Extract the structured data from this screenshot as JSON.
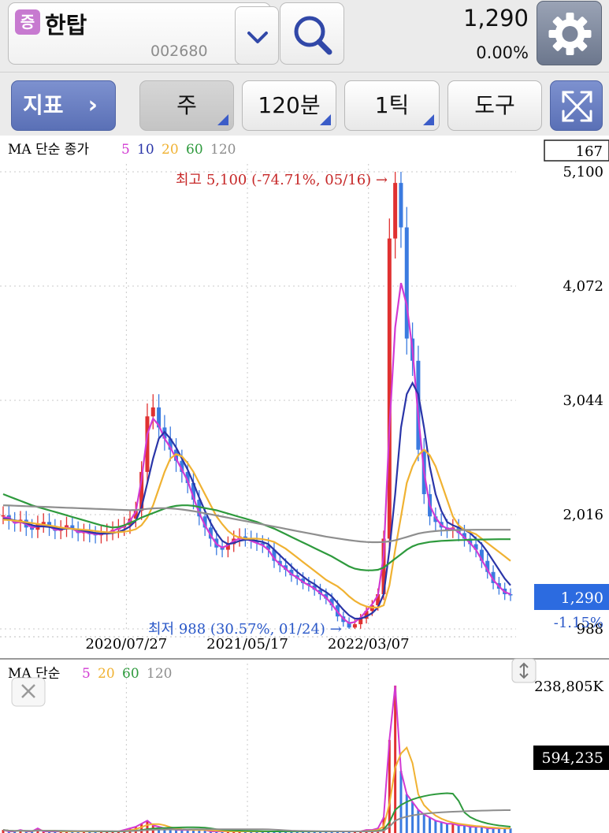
{
  "header": {
    "badge": "증",
    "stock_name": "한탑",
    "stock_code": "002680",
    "price": "1,290",
    "change_pct": "0.00%",
    "icons": [
      "chevron-down-icon",
      "search-icon",
      "gear-icon"
    ]
  },
  "toolbar": {
    "indicator_label": "지표",
    "week_label": "주",
    "minute_label": "120분",
    "tick_label": "1틱",
    "tool_label": "도구",
    "expand_icon": "expand-icon"
  },
  "legend_main": {
    "prefix": "MA 단순 종가",
    "periods": [
      {
        "label": "5",
        "color": "#d23ad3"
      },
      {
        "label": "10",
        "color": "#2a35a8"
      },
      {
        "label": "20",
        "color": "#f0b232"
      },
      {
        "label": "60",
        "color": "#2e9a3d"
      },
      {
        "label": "120",
        "color": "#8e8e8e"
      }
    ]
  },
  "legend_volume": {
    "prefix": "MA 단순",
    "periods": [
      {
        "label": "5",
        "color": "#d23ad3"
      },
      {
        "label": "20",
        "color": "#f0b232"
      },
      {
        "label": "60",
        "color": "#2e9a3d"
      },
      {
        "label": "120",
        "color": "#8e8e8e"
      }
    ]
  },
  "chart_data": {
    "type": "line",
    "title": "",
    "y_ticks": [
      "5,100",
      "4,072",
      "3,044",
      "2,016",
      "988"
    ],
    "y_range": [
      988,
      5100
    ],
    "x_ticks": [
      "2020/07/27",
      "2021/05/17",
      "2022/03/07"
    ],
    "top_box_value": "167",
    "current_price_label": "1,290",
    "current_change_label": "-1.15%",
    "high_annotation": "최고 5,100 (-74.71%, 05/16) →",
    "low_annotation": "최저 988 (30.57%, 01/24) →",
    "grid": true,
    "price_series": [
      2010,
      1960,
      1940,
      1970,
      1900,
      1880,
      1930,
      1950,
      1900,
      1870,
      1890,
      1920,
      1880,
      1850,
      1860,
      1840,
      1830,
      1850,
      1860,
      1880,
      1900,
      1920,
      1980,
      2050,
      2400,
      2900,
      2980,
      2800,
      2700,
      2600,
      2500,
      2400,
      2300,
      2150,
      2000,
      1900,
      1800,
      1720,
      1700,
      1750,
      1800,
      1820,
      1800,
      1780,
      1760,
      1740,
      1700,
      1600,
      1560,
      1520,
      1470,
      1440,
      1400,
      1380,
      1340,
      1300,
      1260,
      1200,
      1100,
      1050,
      1000,
      1030,
      1080,
      1150,
      1200,
      1300,
      1800,
      4500,
      5000,
      4600,
      3600,
      3400,
      2600,
      2200,
      2000,
      1950,
      1900,
      1880,
      1900,
      1850,
      1800,
      1750,
      1700,
      1600,
      1500,
      1400,
      1350,
      1300,
      1290
    ],
    "ma_series": [
      {
        "name": "5",
        "values": [
          1990,
          1990,
          1940,
          1950,
          1930,
          1900,
          1910,
          1920,
          1910,
          1880,
          1880,
          1900,
          1890,
          1860,
          1860,
          1850,
          1840,
          1840,
          1850,
          1870,
          1890,
          1910,
          1960,
          2040,
          2330,
          2740,
          2880,
          2820,
          2700,
          2620,
          2520,
          2420,
          2320,
          2170,
          2030,
          1920,
          1830,
          1750,
          1720,
          1740,
          1780,
          1800,
          1800,
          1780,
          1760,
          1740,
          1700,
          1620,
          1570,
          1530,
          1480,
          1450,
          1410,
          1380,
          1350,
          1310,
          1270,
          1210,
          1140,
          1080,
          1040,
          1050,
          1090,
          1150,
          1210,
          1290,
          1650,
          2800,
          3700,
          4100,
          3900,
          3500,
          2900,
          2400,
          2100,
          1990,
          1920,
          1890,
          1890,
          1860,
          1810,
          1760,
          1700,
          1610,
          1520,
          1430,
          1370,
          1320,
          1300
        ]
      },
      {
        "name": "10",
        "values": [
          1980,
          1975,
          1965,
          1955,
          1940,
          1920,
          1910,
          1910,
          1905,
          1895,
          1885,
          1890,
          1890,
          1880,
          1870,
          1860,
          1850,
          1845,
          1845,
          1850,
          1860,
          1880,
          1910,
          1960,
          2080,
          2300,
          2520,
          2700,
          2760,
          2700,
          2620,
          2520,
          2420,
          2300,
          2170,
          2050,
          1940,
          1850,
          1780,
          1750,
          1760,
          1780,
          1790,
          1790,
          1780,
          1770,
          1750,
          1700,
          1650,
          1600,
          1550,
          1500,
          1460,
          1420,
          1390,
          1350,
          1320,
          1280,
          1220,
          1160,
          1110,
          1080,
          1080,
          1100,
          1130,
          1180,
          1300,
          1700,
          2200,
          2800,
          3100,
          3200,
          3100,
          2800,
          2450,
          2200,
          2050,
          1950,
          1920,
          1900,
          1880,
          1850,
          1800,
          1750,
          1680,
          1600,
          1520,
          1440,
          1380
        ]
      },
      {
        "name": "20",
        "values": [
          1970,
          1968,
          1962,
          1955,
          1948,
          1940,
          1932,
          1925,
          1918,
          1910,
          1900,
          1893,
          1888,
          1884,
          1880,
          1875,
          1868,
          1862,
          1858,
          1856,
          1858,
          1862,
          1870,
          1885,
          1920,
          1990,
          2100,
          2250,
          2400,
          2520,
          2560,
          2540,
          2480,
          2400,
          2300,
          2200,
          2100,
          2000,
          1930,
          1870,
          1830,
          1810,
          1800,
          1800,
          1800,
          1795,
          1785,
          1770,
          1740,
          1710,
          1670,
          1630,
          1590,
          1550,
          1510,
          1470,
          1430,
          1400,
          1370,
          1330,
          1280,
          1240,
          1210,
          1190,
          1180,
          1180,
          1200,
          1380,
          1700,
          2000,
          2300,
          2450,
          2550,
          2600,
          2550,
          2450,
          2300,
          2150,
          2000,
          1920,
          1880,
          1860,
          1840,
          1800,
          1760,
          1720,
          1680,
          1640,
          1600
        ]
      },
      {
        "name": "60",
        "values": [
          2200,
          2180,
          2160,
          2140,
          2120,
          2100,
          2085,
          2070,
          2055,
          2040,
          2025,
          2010,
          1995,
          1980,
          1965,
          1950,
          1935,
          1920,
          1910,
          1900,
          1905,
          1920,
          1940,
          1965,
          1990,
          2010,
          2030,
          2050,
          2070,
          2085,
          2095,
          2100,
          2100,
          2095,
          2085,
          2075,
          2065,
          2055,
          2040,
          2025,
          2010,
          1995,
          1980,
          1965,
          1950,
          1930,
          1910,
          1890,
          1865,
          1840,
          1815,
          1790,
          1765,
          1740,
          1715,
          1690,
          1665,
          1640,
          1610,
          1580,
          1550,
          1530,
          1520,
          1515,
          1515,
          1520,
          1540,
          1580,
          1620,
          1660,
          1700,
          1730,
          1750,
          1760,
          1770,
          1775,
          1780,
          1782,
          1785,
          1787,
          1788,
          1790,
          1791,
          1792,
          1793,
          1794,
          1795,
          1795,
          1795
        ]
      },
      {
        "name": "120",
        "values": [
          2100,
          2098,
          2096,
          2094,
          2092,
          2090,
          2088,
          2086,
          2084,
          2082,
          2080,
          2078,
          2076,
          2074,
          2072,
          2070,
          2068,
          2066,
          2064,
          2062,
          2060,
          2058,
          2056,
          2058,
          2062,
          2068,
          2072,
          2074,
          2074,
          2072,
          2068,
          2062,
          2055,
          2047,
          2038,
          2028,
          2018,
          2008,
          1998,
          1988,
          1978,
          1968,
          1958,
          1948,
          1938,
          1928,
          1918,
          1908,
          1898,
          1888,
          1878,
          1868,
          1858,
          1848,
          1838,
          1828,
          1818,
          1810,
          1802,
          1794,
          1786,
          1780,
          1774,
          1770,
          1768,
          1768,
          1770,
          1775,
          1785,
          1800,
          1815,
          1830,
          1845,
          1855,
          1862,
          1868,
          1872,
          1874,
          1876,
          1877,
          1878,
          1879,
          1880,
          1880,
          1880,
          1880,
          1880,
          1880,
          1880
        ]
      }
    ],
    "volume_ticks": [
      "238,805K"
    ],
    "volume_box_value": "594,235",
    "volume_series": [
      2,
      1,
      1,
      2,
      1,
      1,
      3,
      1,
      1,
      1,
      1,
      1,
      1,
      1,
      1,
      1,
      1,
      1,
      1,
      1,
      1,
      2,
      3,
      4,
      6,
      8,
      5,
      4,
      3,
      3,
      2,
      2,
      2,
      2,
      2,
      2,
      1,
      1,
      1,
      1,
      1,
      1,
      1,
      1,
      1,
      1,
      1,
      1,
      1,
      1,
      1,
      1,
      1,
      1,
      1,
      1,
      1,
      1,
      1,
      1,
      1,
      1,
      1,
      2,
      2,
      3,
      10,
      60,
      95,
      40,
      25,
      20,
      15,
      12,
      10,
      8,
      7,
      6,
      6,
      5,
      5,
      4,
      4,
      4,
      3,
      3,
      3,
      3,
      3
    ]
  }
}
